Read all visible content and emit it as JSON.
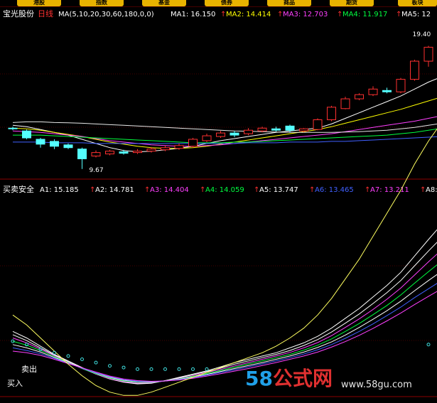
{
  "toolbar": {
    "buttons": [
      "港股",
      "指数",
      "基金",
      "债券",
      "商品",
      "期货",
      "板块"
    ]
  },
  "upper": {
    "stock_name": "宝光股份",
    "period": "日线",
    "ma_params": "MA(5,10,20,30,60,180,0,0)",
    "ma_values": [
      {
        "label": "MA1: 16.150",
        "arrow": "↑",
        "color": "#ffffff"
      },
      {
        "label": "MA2: 14.414",
        "arrow": "↑",
        "color": "#ffff00"
      },
      {
        "label": "MA3: 12.703",
        "arrow": "↑",
        "color": "#ff40ff"
      },
      {
        "label": "MA4: 11.917",
        "arrow": "↑",
        "color": "#00ff40"
      },
      {
        "label": "MA5: 12",
        "arrow": "",
        "color": "#ffffff"
      }
    ],
    "high_label": "19.40",
    "low_label": "9.67"
  },
  "lower": {
    "indicator_name": "买卖安全",
    "values": [
      {
        "label": "A1: 15.185",
        "arrow": "↑",
        "color": "#ffffff"
      },
      {
        "label": "A2: 14.781",
        "arrow": "↑",
        "color": "#ffffff"
      },
      {
        "label": "A3: 14.404",
        "arrow": "↑",
        "color": "#ff40ff"
      },
      {
        "label": "A4: 14.059",
        "arrow": "↑",
        "color": "#00ff40"
      },
      {
        "label": "A5: 13.747",
        "arrow": "↑",
        "color": "#ffffff"
      },
      {
        "label": "A6: 13.465",
        "arrow": "↑",
        "color": "#4060ff"
      },
      {
        "label": "A7: 13.211",
        "arrow": "↑",
        "color": "#ff40ff"
      },
      {
        "label": "A8:",
        "arrow": "",
        "color": "#ffffff"
      }
    ],
    "sell_label": "卖出",
    "buy_label": "买入"
  },
  "watermark": {
    "logo_num": "58",
    "logo_text": "公式网",
    "url": "www.58gu.com"
  },
  "colors": {
    "up": "#ff3030",
    "down": "#54ffff",
    "grid": "#8b0000",
    "ma1": "#ffffff",
    "ma2": "#ffff00",
    "ma3": "#ff40ff",
    "ma4": "#00ff40",
    "ma5": "#4060ff"
  },
  "chart_data": {
    "type": "candlestick",
    "candles": [
      {
        "o": 12.6,
        "c": 12.55,
        "h": 12.7,
        "l": 12.45
      },
      {
        "o": 12.4,
        "c": 11.9,
        "h": 12.5,
        "l": 11.8
      },
      {
        "o": 11.8,
        "c": 11.45,
        "h": 11.9,
        "l": 11.2
      },
      {
        "o": 11.65,
        "c": 11.3,
        "h": 11.8,
        "l": 11.1
      },
      {
        "o": 11.4,
        "c": 11.2,
        "h": 11.5,
        "l": 11.1
      },
      {
        "o": 11.1,
        "c": 10.4,
        "h": 11.2,
        "l": 9.67
      },
      {
        "o": 10.6,
        "c": 10.85,
        "h": 11.0,
        "l": 10.5
      },
      {
        "o": 10.75,
        "c": 10.95,
        "h": 11.05,
        "l": 10.65
      },
      {
        "o": 10.9,
        "c": 10.8,
        "h": 11.05,
        "l": 10.7
      },
      {
        "o": 10.85,
        "c": 10.95,
        "h": 11.1,
        "l": 10.75
      },
      {
        "o": 10.95,
        "c": 11.1,
        "h": 11.25,
        "l": 10.85
      },
      {
        "o": 11.05,
        "c": 11.2,
        "h": 11.35,
        "l": 10.95
      },
      {
        "o": 11.15,
        "c": 11.35,
        "h": 11.5,
        "l": 11.05
      },
      {
        "o": 11.3,
        "c": 11.8,
        "h": 11.9,
        "l": 11.2
      },
      {
        "o": 11.7,
        "c": 12.05,
        "h": 12.2,
        "l": 11.6
      },
      {
        "o": 12.0,
        "c": 12.25,
        "h": 12.4,
        "l": 11.9
      },
      {
        "o": 12.25,
        "c": 12.1,
        "h": 12.4,
        "l": 11.95
      },
      {
        "o": 12.2,
        "c": 12.45,
        "h": 12.6,
        "l": 12.1
      },
      {
        "o": 12.4,
        "c": 12.6,
        "h": 12.7,
        "l": 12.3
      },
      {
        "o": 12.55,
        "c": 12.45,
        "h": 12.7,
        "l": 12.35
      },
      {
        "o": 12.75,
        "c": 12.45,
        "h": 12.85,
        "l": 12.3
      },
      {
        "o": 12.4,
        "c": 12.55,
        "h": 12.6,
        "l": 12.3
      },
      {
        "o": 12.5,
        "c": 13.2,
        "h": 13.3,
        "l": 12.45
      },
      {
        "o": 13.2,
        "c": 14.1,
        "h": 14.2,
        "l": 13.1
      },
      {
        "o": 14.0,
        "c": 14.7,
        "h": 14.85,
        "l": 13.95
      },
      {
        "o": 14.7,
        "c": 15.0,
        "h": 15.1,
        "l": 14.6
      },
      {
        "o": 15.0,
        "c": 15.4,
        "h": 15.6,
        "l": 14.9
      },
      {
        "o": 15.3,
        "c": 15.2,
        "h": 15.5,
        "l": 15.1
      },
      {
        "o": 15.2,
        "c": 16.1,
        "h": 16.2,
        "l": 15.1
      },
      {
        "o": 16.1,
        "c": 17.4,
        "h": 17.5,
        "l": 16.0
      },
      {
        "o": 17.4,
        "c": 18.4,
        "h": 18.5,
        "l": 17.0
      },
      {
        "o": 18.4,
        "c": 18.45,
        "h": 19.4,
        "l": 18.2
      }
    ],
    "ylim": [
      9.2,
      19.9
    ],
    "ma1": [
      12.8,
      12.7,
      12.5,
      12.3,
      12.1,
      11.8,
      11.5,
      11.2,
      11.0,
      10.9,
      10.95,
      11.05,
      11.15,
      11.3,
      11.5,
      11.7,
      11.85,
      12.0,
      12.15,
      12.3,
      12.4,
      12.5,
      12.6,
      12.9,
      13.3,
      13.7,
      14.1,
      14.5,
      14.9,
      15.4,
      15.9,
      16.3
    ],
    "ma2": [
      12.6,
      12.55,
      12.45,
      12.3,
      12.15,
      12.0,
      11.8,
      11.6,
      11.45,
      11.3,
      11.2,
      11.15,
      11.15,
      11.2,
      11.3,
      11.45,
      11.6,
      11.75,
      11.9,
      12.05,
      12.2,
      12.35,
      12.5,
      12.7,
      12.95,
      13.2,
      13.45,
      13.7,
      13.95,
      14.25,
      14.55,
      14.85
    ],
    "ma3": [
      12.4,
      12.35,
      12.3,
      12.2,
      12.1,
      12.0,
      11.85,
      11.7,
      11.6,
      11.5,
      11.4,
      11.35,
      11.3,
      11.3,
      11.35,
      11.4,
      11.5,
      11.6,
      11.7,
      11.8,
      11.9,
      12.0,
      12.1,
      12.2,
      12.35,
      12.5,
      12.65,
      12.8,
      12.95,
      13.1,
      13.3,
      13.5
    ],
    "ma4": [
      12.1,
      12.1,
      12.1,
      12.05,
      12.0,
      11.95,
      11.9,
      11.85,
      11.8,
      11.75,
      11.7,
      11.65,
      11.6,
      11.55,
      11.55,
      11.55,
      11.6,
      11.6,
      11.65,
      11.7,
      11.75,
      11.8,
      11.85,
      11.9,
      11.95,
      12.0,
      12.05,
      12.1,
      12.2,
      12.3,
      12.45,
      12.6
    ],
    "ma5": [
      13.0,
      13.05,
      13.05,
      13.0,
      12.98,
      12.95,
      12.9,
      12.85,
      12.8,
      12.75,
      12.7,
      12.65,
      12.6,
      12.55,
      12.5,
      12.45,
      12.4,
      12.38,
      12.35,
      12.32,
      12.3,
      12.3,
      12.3,
      12.3,
      12.32,
      12.35,
      12.4,
      12.45,
      12.55,
      12.65,
      12.8,
      12.95
    ],
    "ma6": [
      11.6,
      11.6,
      11.6,
      11.55,
      11.55,
      11.55,
      11.5,
      11.5,
      11.5,
      11.5,
      11.5,
      11.5,
      11.5,
      11.5,
      11.5,
      11.5,
      11.5,
      11.55,
      11.55,
      11.55,
      11.6,
      11.6,
      11.6,
      11.65,
      11.65,
      11.7,
      11.75,
      11.8,
      11.85,
      11.9,
      11.95,
      12.0
    ],
    "lower_ylim": [
      10.0,
      16.0
    ],
    "lower_lines": [
      {
        "name": "A1",
        "color": "#ffffff",
        "values": [
          11.9,
          11.7,
          11.45,
          11.2,
          11.0,
          10.8,
          10.6,
          10.45,
          10.35,
          10.3,
          10.32,
          10.4,
          10.5,
          10.6,
          10.7,
          10.82,
          10.95,
          11.05,
          11.15,
          11.25,
          11.4,
          11.55,
          11.75,
          12.0,
          12.3,
          12.6,
          12.95,
          13.3,
          13.7,
          14.2,
          14.7,
          15.185
        ]
      },
      {
        "name": "A2",
        "color": "#ffffff",
        "values": [
          11.8,
          11.62,
          11.4,
          11.18,
          10.98,
          10.78,
          10.6,
          10.45,
          10.36,
          10.32,
          10.33,
          10.4,
          10.48,
          10.58,
          10.68,
          10.78,
          10.9,
          11.0,
          11.1,
          11.2,
          11.32,
          11.47,
          11.65,
          11.88,
          12.15,
          12.43,
          12.75,
          13.08,
          13.45,
          13.9,
          14.35,
          14.781
        ]
      },
      {
        "name": "A3",
        "color": "#ff40ff",
        "values": [
          11.7,
          11.55,
          11.36,
          11.16,
          10.96,
          10.77,
          10.6,
          10.46,
          10.37,
          10.33,
          10.34,
          10.39,
          10.46,
          10.55,
          10.65,
          10.74,
          10.85,
          10.95,
          11.05,
          11.15,
          11.26,
          11.4,
          11.56,
          11.77,
          12.02,
          12.28,
          12.57,
          12.88,
          13.22,
          13.62,
          14.02,
          14.404
        ]
      },
      {
        "name": "A4",
        "color": "#00ff40",
        "values": [
          11.6,
          11.48,
          11.32,
          11.14,
          10.95,
          10.77,
          10.61,
          10.48,
          10.39,
          10.35,
          10.35,
          10.39,
          10.45,
          10.53,
          10.62,
          10.71,
          10.81,
          10.91,
          11.0,
          11.1,
          11.2,
          11.33,
          11.48,
          11.67,
          11.9,
          12.14,
          12.41,
          12.69,
          13.01,
          13.37,
          13.72,
          14.059
        ]
      },
      {
        "name": "A5",
        "color": "#ffffff",
        "values": [
          11.5,
          11.4,
          11.27,
          11.11,
          10.94,
          10.78,
          10.63,
          10.5,
          10.41,
          10.37,
          10.36,
          10.39,
          10.44,
          10.51,
          10.59,
          10.68,
          10.77,
          10.86,
          10.95,
          11.05,
          11.15,
          11.27,
          11.41,
          11.58,
          11.79,
          12.02,
          12.27,
          12.53,
          12.82,
          13.14,
          13.45,
          13.747
        ]
      },
      {
        "name": "A6",
        "color": "#4060ff",
        "values": [
          11.4,
          11.32,
          11.22,
          11.08,
          10.93,
          10.78,
          10.64,
          10.52,
          10.43,
          10.38,
          10.37,
          10.39,
          10.43,
          10.49,
          10.57,
          10.65,
          10.73,
          10.82,
          10.91,
          11.0,
          11.1,
          11.21,
          11.34,
          11.5,
          11.69,
          11.9,
          12.13,
          12.38,
          12.64,
          12.93,
          13.2,
          13.465
        ]
      },
      {
        "name": "A7",
        "color": "#ff40ff",
        "values": [
          11.3,
          11.25,
          11.17,
          11.05,
          10.92,
          10.79,
          10.66,
          10.54,
          10.45,
          10.4,
          10.38,
          10.39,
          10.42,
          10.47,
          10.54,
          10.61,
          10.69,
          10.77,
          10.86,
          10.95,
          11.05,
          11.15,
          11.27,
          11.42,
          11.59,
          11.78,
          11.99,
          12.22,
          12.46,
          12.72,
          12.97,
          13.211
        ]
      },
      {
        "name": "A8",
        "color": "#ffff60",
        "values": [
          12.4,
          12.1,
          11.7,
          11.3,
          10.9,
          10.55,
          10.25,
          10.05,
          9.95,
          9.95,
          10.05,
          10.2,
          10.35,
          10.5,
          10.65,
          10.8,
          10.95,
          11.1,
          11.25,
          11.45,
          11.7,
          12.0,
          12.4,
          12.9,
          13.5,
          14.1,
          14.8,
          15.5,
          16.2,
          17.0,
          17.7,
          18.3
        ]
      }
    ],
    "sar_dots": [
      11.6,
      11.5,
      11.35,
      11.25,
      11.15,
      11.05,
      10.95,
      10.85,
      10.8,
      10.75,
      10.75,
      10.75,
      10.75,
      10.75,
      10.75,
      null,
      null,
      null,
      null,
      null,
      null,
      null,
      null,
      null,
      null,
      null,
      null,
      null,
      null,
      null,
      11.5,
      11.8
    ]
  }
}
